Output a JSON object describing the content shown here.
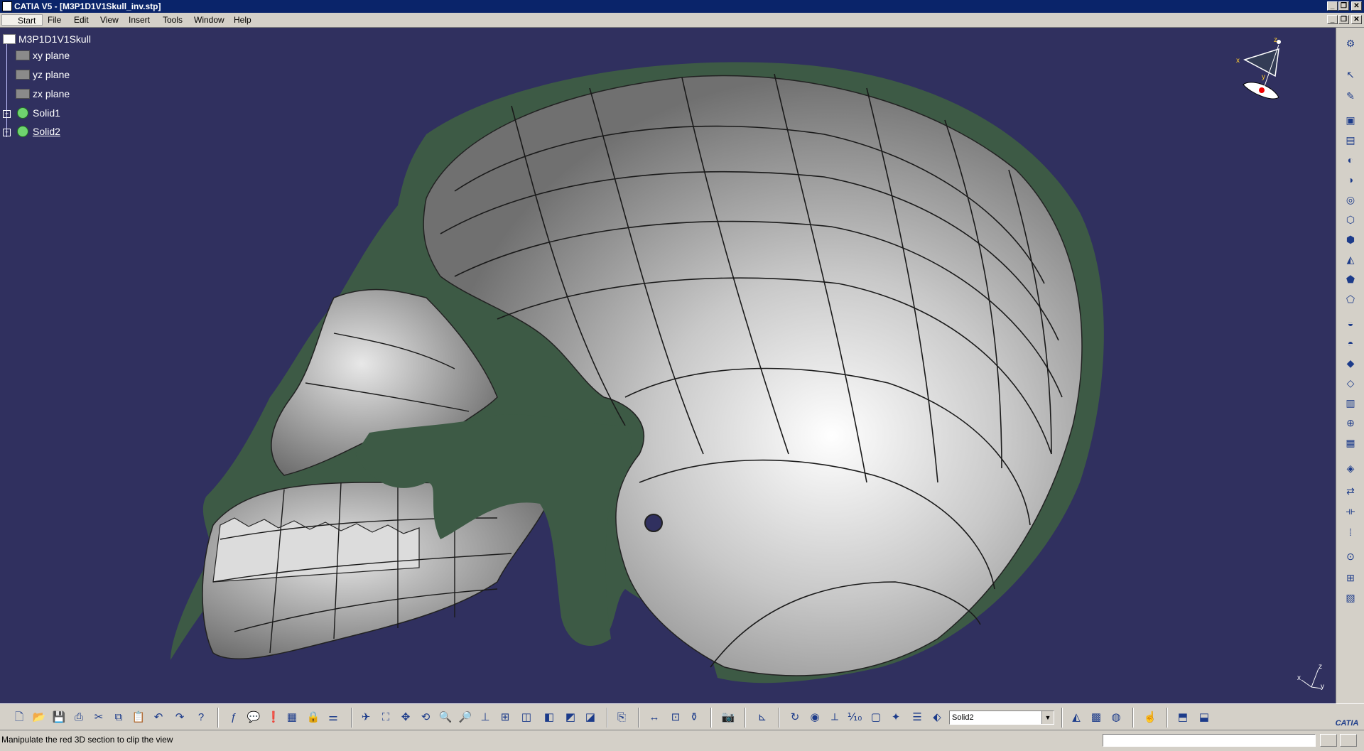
{
  "window": {
    "title": "CATIA V5 - [M3P1D1V1Skull_inv.stp]",
    "controls": [
      "minimize",
      "restore",
      "close"
    ]
  },
  "menu": {
    "items": [
      "Start",
      "File",
      "Edit",
      "View",
      "Insert",
      "Tools",
      "Window",
      "Help"
    ]
  },
  "tree": {
    "root": "M3P1D1V1Skull",
    "children": [
      {
        "label": "xy plane",
        "icon": "plane-icon"
      },
      {
        "label": "yz plane",
        "icon": "plane-icon"
      },
      {
        "label": "zx plane",
        "icon": "plane-icon"
      },
      {
        "label": "Solid1",
        "icon": "solid-icon"
      },
      {
        "label": "Solid2",
        "icon": "solid-icon"
      }
    ]
  },
  "compass": {
    "x": "x",
    "y": "y",
    "z": "z"
  },
  "axis_triad": {
    "x": "x",
    "y": "y",
    "z": "z"
  },
  "toolbar": {
    "current_body": "Solid2"
  },
  "status": {
    "message": "Manipulate the red 3D section to clip the view"
  },
  "colors": {
    "viewport_bg": "#30305f",
    "section_fill": "#3d5a45",
    "title_bar": "#0a246a",
    "chrome": "#d4d0c8"
  }
}
